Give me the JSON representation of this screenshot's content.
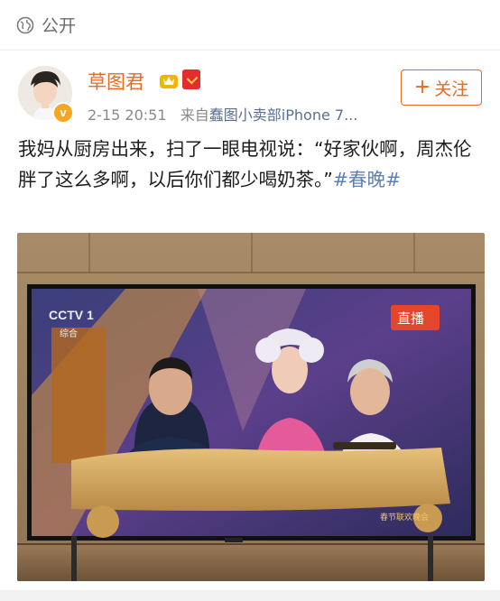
{
  "visibility": {
    "label": "公开",
    "icon": "globe-icon"
  },
  "author": {
    "name": "草图君",
    "badges": [
      "member-crown-icon",
      "red-envelope-icon"
    ],
    "verified_icon": "verified-v-icon",
    "verified_char": "v"
  },
  "meta": {
    "time": "2-15 20:51",
    "source_prefix": "来自",
    "source": "蠢图小卖部iPhone 7..."
  },
  "follow": {
    "plus": "+",
    "label": "关注"
  },
  "post": {
    "text": "我妈从厨房出来，扫了一眼电视说：“好家伙啊，周杰伦胖了这么多啊，以后你们都少喝奶茶。”",
    "hashtag": "#春晚#"
  },
  "photo": {
    "channel_logo": "CCTV 1",
    "channel_sub": "综合",
    "live_label": "直播",
    "festival_label": "春节联欢晚会"
  },
  "colors": {
    "accent": "#ea6a1f",
    "link": "#5b7fb8",
    "meta": "#8a8a8a"
  }
}
